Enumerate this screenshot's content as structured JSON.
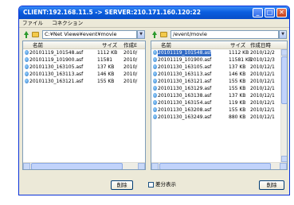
{
  "window": {
    "title": "CLIENT:192.168.11.5 -> SERVER:210.171.160.120:22",
    "minimize": "_",
    "maximize": "□",
    "close": "✕"
  },
  "menu": {
    "items": [
      "ファイル",
      "コネクション"
    ]
  },
  "left": {
    "path": "C:¥Net Viewe¥event¥movie",
    "headers": {
      "name": "名前",
      "size": "サイズ",
      "date": "作成E"
    },
    "files": [
      {
        "name": "20101119_101548.asf",
        "size": "1112 KB",
        "date": "2010/"
      },
      {
        "name": "20101119_101900.asf",
        "size": "11581",
        "date": "2010/"
      },
      {
        "name": "20101130_163105.asf",
        "size": "137 KB",
        "date": "2010/"
      },
      {
        "name": "20101130_163113.asf",
        "size": "146 KB",
        "date": "2010/"
      },
      {
        "name": "20101130_163121.asf",
        "size": "155 KB",
        "date": "2010/"
      }
    ],
    "delete_label": "削除"
  },
  "right": {
    "path": "/event/movie",
    "headers": {
      "name": "名前",
      "size": "サイズ",
      "date": "作成日時"
    },
    "files": [
      {
        "name": "20101119_101548.asf",
        "size": "1112 KB",
        "date": "2010/12/2"
      },
      {
        "name": "20101119_101900.asf",
        "size": "11581 KB",
        "date": "2010/12/3"
      },
      {
        "name": "20101130_163105.asf",
        "size": "137 KB",
        "date": "2010/12/1"
      },
      {
        "name": "20101130_163113.asf",
        "size": "146 KB",
        "date": "2010/12/1"
      },
      {
        "name": "20101130_163121.asf",
        "size": "155 KB",
        "date": "2010/12/1"
      },
      {
        "name": "20101130_163129.asf",
        "size": "155 KB",
        "date": "2010/12/1"
      },
      {
        "name": "20101130_163138.asf",
        "size": "137 KB",
        "date": "2010/12/1"
      },
      {
        "name": "20101130_163154.asf",
        "size": "119 KB",
        "date": "2010/12/1"
      },
      {
        "name": "20101130_163208.asf",
        "size": "155 KB",
        "date": "2010/12/1"
      },
      {
        "name": "20101130_163249.asf",
        "size": "880 KB",
        "date": "2010/12/1"
      }
    ],
    "delete_label": "削除"
  },
  "diff_label": "差分表示",
  "colors": {
    "title_bar": "#0a5ee0",
    "selection": "#316ac5",
    "face": "#ece9d8"
  }
}
